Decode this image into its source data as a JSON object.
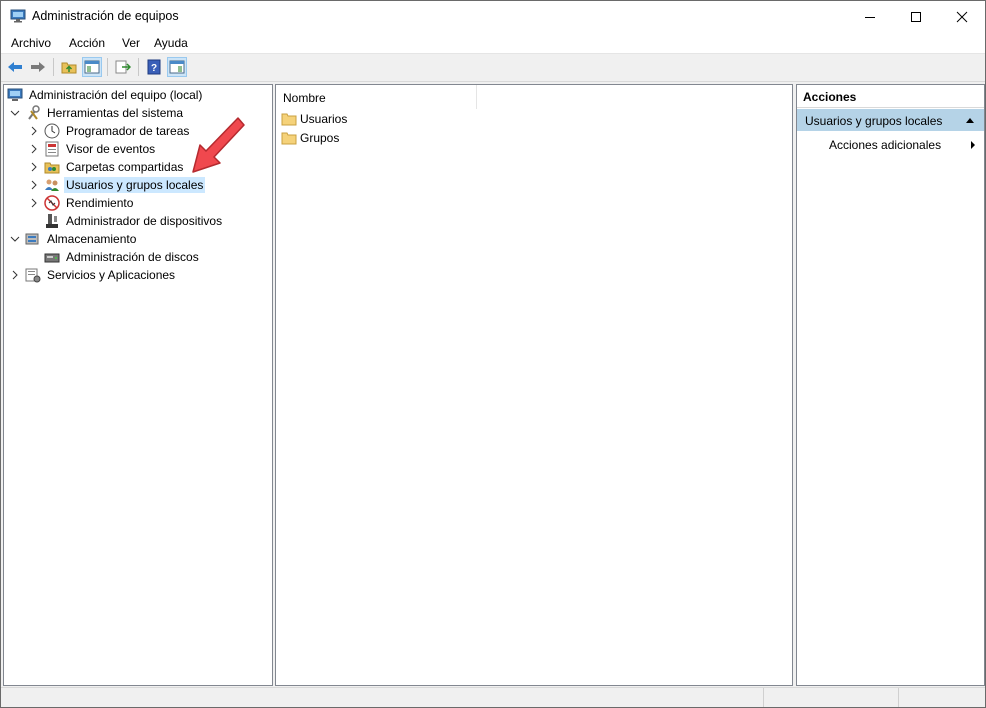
{
  "window": {
    "title": "Administración de equipos"
  },
  "menu": [
    "Archivo",
    "Acción",
    "Ver",
    "Ayuda"
  ],
  "toolbar": {
    "buttons": [
      "back-icon",
      "forward-icon",
      "up-folder-icon",
      "show-hide-tree-icon",
      "export-list-icon",
      "help-icon",
      "show-hide-action-pane-icon"
    ]
  },
  "tree": {
    "root": "Administración del equipo (local)",
    "items": [
      {
        "label": "Herramientas del sistema",
        "expanded": true
      },
      {
        "label": "Programador de tareas"
      },
      {
        "label": "Visor de eventos"
      },
      {
        "label": "Carpetas compartidas"
      },
      {
        "label": "Usuarios y grupos locales",
        "selected": true
      },
      {
        "label": "Rendimiento"
      },
      {
        "label": "Administrador de dispositivos"
      },
      {
        "label": "Almacenamiento",
        "expanded": true
      },
      {
        "label": "Administración de discos"
      },
      {
        "label": "Servicios y Aplicaciones",
        "expanded": false
      }
    ]
  },
  "list": {
    "column_header": "Nombre",
    "rows": [
      "Usuarios",
      "Grupos"
    ]
  },
  "actions": {
    "title": "Acciones",
    "group": "Usuarios y grupos locales",
    "item": "Acciones adicionales"
  },
  "colors": {
    "selection": "#cce8ff",
    "action_group": "#b5d3e7",
    "arrow": "#f0484e",
    "accent": "#2f7fd0"
  }
}
